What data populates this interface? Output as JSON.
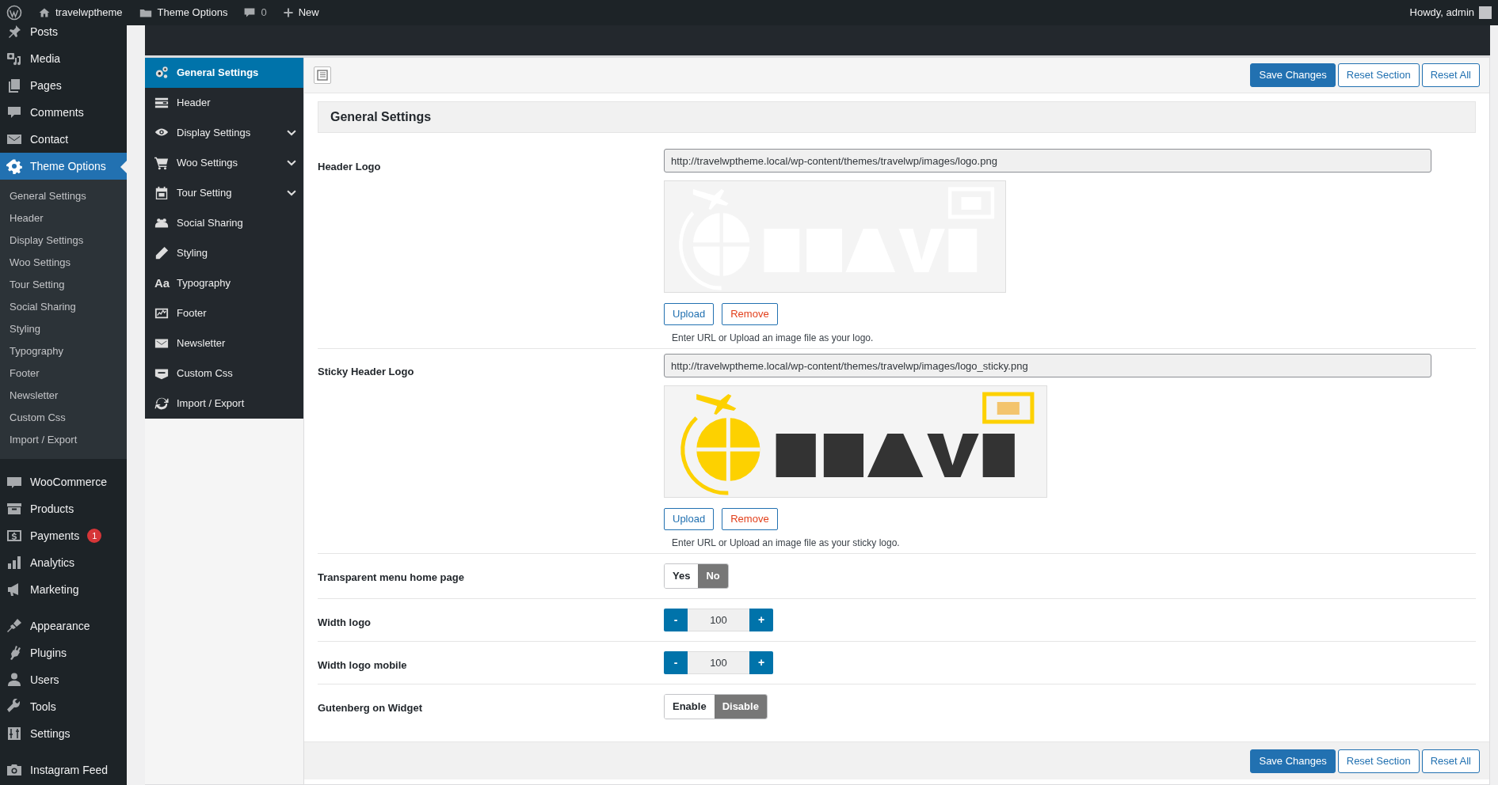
{
  "admin_bar": {
    "site": "travelwptheme",
    "section": "Theme Options",
    "comments": "0",
    "new": "New",
    "greeting": "Howdy, admin"
  },
  "admin_menu": [
    [
      {
        "label": "Posts",
        "selected": false
      },
      {
        "label": "Media",
        "selected": false
      },
      {
        "label": "Pages",
        "selected": false
      },
      {
        "label": "Comments",
        "selected": false
      },
      {
        "label": "Contact",
        "selected": false
      },
      {
        "label": "Theme Options",
        "selected": true,
        "children": [
          {
            "label": "General Settings"
          },
          {
            "label": "Header"
          },
          {
            "label": "Display Settings"
          },
          {
            "label": "Woo Settings"
          },
          {
            "label": "Tour Setting"
          },
          {
            "label": "Social Sharing"
          },
          {
            "label": "Styling"
          },
          {
            "label": "Typography"
          },
          {
            "label": "Footer"
          },
          {
            "label": "Newsletter"
          },
          {
            "label": "Custom Css"
          },
          {
            "label": "Import / Export"
          }
        ]
      }
    ],
    [
      {
        "label": "WooCommerce",
        "selected": false
      },
      {
        "label": "Products",
        "selected": false
      },
      {
        "label": "Payments",
        "selected": false,
        "badge": "1"
      },
      {
        "label": "Analytics",
        "selected": false
      },
      {
        "label": "Marketing",
        "selected": false
      }
    ],
    [
      {
        "label": "Appearance",
        "selected": false
      },
      {
        "label": "Plugins",
        "selected": false
      },
      {
        "label": "Users",
        "selected": false
      },
      {
        "label": "Tools",
        "selected": false
      },
      {
        "label": "Settings",
        "selected": false
      }
    ],
    [
      {
        "label": "Instagram Feed",
        "selected": false
      }
    ]
  ],
  "options_menu": [
    {
      "label": "General Settings",
      "selected": true,
      "has_submenu": false
    },
    {
      "label": "Header",
      "selected": false,
      "has_submenu": false
    },
    {
      "label": "Display Settings",
      "selected": false,
      "has_submenu": true
    },
    {
      "label": "Woo Settings",
      "selected": false,
      "has_submenu": true
    },
    {
      "label": "Tour Setting",
      "selected": false,
      "has_submenu": true
    },
    {
      "label": "Social Sharing",
      "selected": false,
      "has_submenu": false
    },
    {
      "label": "Styling",
      "selected": false,
      "has_submenu": false
    },
    {
      "label": "Typography",
      "selected": false,
      "has_submenu": false,
      "glyph": "Aa"
    },
    {
      "label": "Footer",
      "selected": false,
      "has_submenu": false
    },
    {
      "label": "Newsletter",
      "selected": false,
      "has_submenu": false
    },
    {
      "label": "Custom Css",
      "selected": false,
      "has_submenu": false
    },
    {
      "label": "Import / Export",
      "selected": false,
      "has_submenu": false
    }
  ],
  "toolbar": {
    "buttons": [
      "Save Changes",
      "Reset Section",
      "Reset All"
    ]
  },
  "section_title": "General Settings",
  "fields": [
    {
      "kind": "media",
      "label": "Header Logo",
      "value": "http://travelwptheme.local/wp-content/themes/travelwp/images/logo.png",
      "preview": {
        "kind": "picture"
      },
      "buttons": [
        "Upload",
        "Remove"
      ],
      "help": "Enter URL or Upload an image file as your logo."
    },
    {
      "kind": "media",
      "label": "Sticky Header Logo",
      "value": "http://travelwptheme.local/wp-content/themes/travelwp/images/logo_sticky.png",
      "preview": {
        "kind": "picture"
      },
      "buttons": [
        "Upload",
        "Remove"
      ],
      "help": "Enter URL or Upload an image file as your sticky logo."
    },
    {
      "kind": "toggle",
      "label": "Transparent menu home page",
      "options": [
        {
          "label": "Yes",
          "selected": false
        },
        {
          "label": "No",
          "selected": true
        }
      ]
    },
    {
      "kind": "spinner",
      "label": "Width logo",
      "value": "100",
      "minus": "-",
      "plus": "+"
    },
    {
      "kind": "spinner",
      "label": "Width logo mobile",
      "value": "100",
      "minus": "-",
      "plus": "+"
    },
    {
      "kind": "toggle",
      "label": "Gutenberg on Widget",
      "options": [
        {
          "label": "Enable",
          "selected": false
        },
        {
          "label": "Disable",
          "selected": true
        }
      ]
    }
  ],
  "footer": {
    "buttons": [
      "Save Changes",
      "Reset Section",
      "Reset All"
    ]
  }
}
